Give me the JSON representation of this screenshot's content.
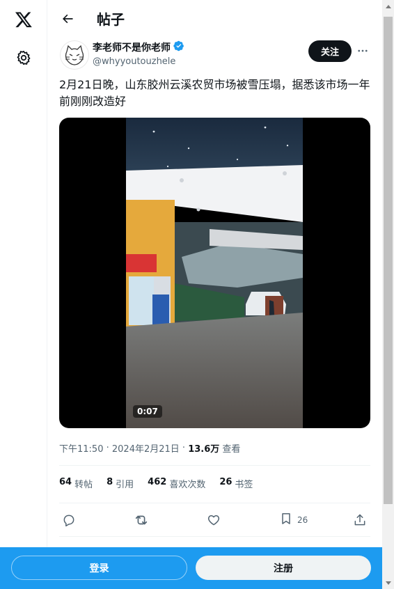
{
  "rail": {
    "logo_icon": "x-logo-icon",
    "settings_icon": "gear-icon"
  },
  "header": {
    "back_icon": "arrow-left-icon",
    "title": "帖子"
  },
  "author": {
    "name": "李老师不是你老师",
    "handle": "@whyyoutouzhele",
    "verified": true,
    "follow_label": "关注",
    "more_icon": "more-horizontal-icon"
  },
  "tweet": {
    "text": "2月21日晚，山东胶州云溪农贸市场被雪压塌，据悉该市场一年前刚刚改造好",
    "video_duration": "0:07",
    "time": "下午11:50",
    "sep1": " · ",
    "date": "2024年2月21日",
    "sep2": " · ",
    "views": "13.6万",
    "views_label": " 查看"
  },
  "stats": [
    {
      "value": "64",
      "label": "转帖"
    },
    {
      "value": "8",
      "label": "引用"
    },
    {
      "value": "462",
      "label": "喜欢次数"
    },
    {
      "value": "26",
      "label": "书签"
    }
  ],
  "actions": {
    "reply_icon": "reply-icon",
    "retweet_icon": "retweet-icon",
    "like_icon": "heart-icon",
    "bookmark_icon": "bookmark-icon",
    "bookmark_count": "26",
    "share_icon": "share-icon"
  },
  "bottom_bar": {
    "login_label": "登录",
    "signup_label": "注册"
  },
  "colors": {
    "brand_blue": "#1d9bf0",
    "text": "#0f1419",
    "secondary": "#536471",
    "verified": "#1d9bf0"
  }
}
